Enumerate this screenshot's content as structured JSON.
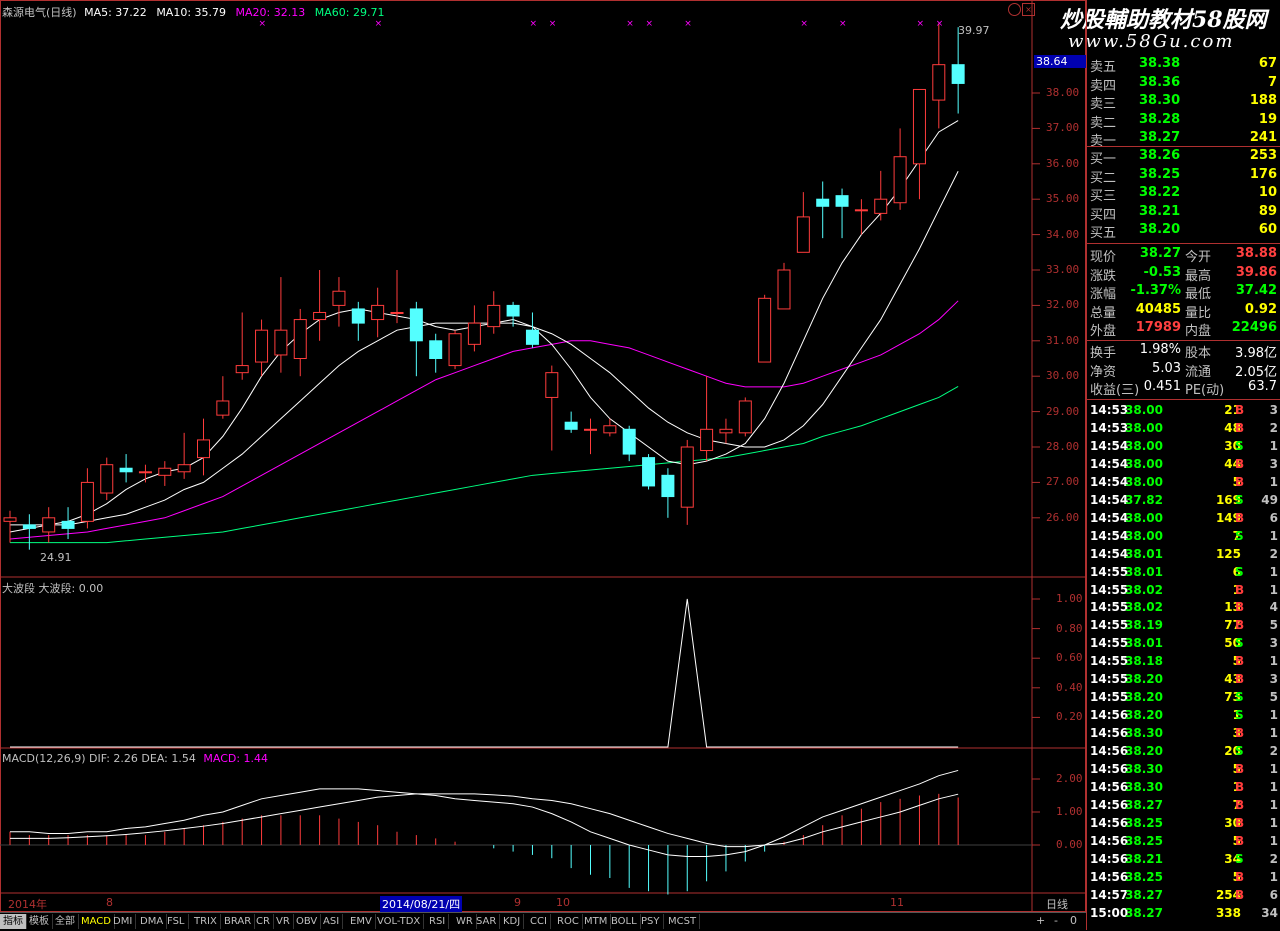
{
  "header": {
    "stock_name": "森源电气(日线)",
    "ma5": "MA5: 37.22",
    "ma10": "MA10: 35.79",
    "ma20": "MA20: 32.13",
    "ma60": "MA60: 29.71",
    "ma5_color": "#ffffff",
    "ma10_color": "#ffffff",
    "ma20_color": "#ff00ff",
    "ma60_color": "#00ff80"
  },
  "watermark": {
    "line1": "炒股輔助教材58股网",
    "line2": "www.58Gu.com"
  },
  "price_axis": {
    "labels": [
      "38.00",
      "37.00",
      "36.00",
      "35.00",
      "34.00",
      "33.00",
      "32.00",
      "31.00",
      "30.00",
      "29.00",
      "28.00",
      "27.00",
      "26.00"
    ],
    "current_tag": "38.64",
    "high_marker": "39.97",
    "low_marker": "24.91"
  },
  "indicator1": {
    "title": "大波段  大波段: 0.00",
    "axis": [
      "1.00",
      "0.80",
      "0.60",
      "0.40",
      "0.20"
    ]
  },
  "macd": {
    "title_prefix": "MACD(12,26,9)  DIF: 2.26  DEA: 1.54",
    "macd_value": "MACD: 1.44",
    "axis": [
      "2.00",
      "1.00",
      "0.00"
    ]
  },
  "x_axis": {
    "labels": [
      "2014年",
      "8",
      "2014/08/21/四",
      "9",
      "10",
      "11"
    ],
    "period": "日线"
  },
  "orderbook": {
    "asks": [
      {
        "label": "卖五",
        "price": "38.38",
        "vol": "67"
      },
      {
        "label": "卖四",
        "price": "38.36",
        "vol": "7"
      },
      {
        "label": "卖三",
        "price": "38.30",
        "vol": "188"
      },
      {
        "label": "卖二",
        "price": "38.28",
        "vol": "19"
      },
      {
        "label": "卖一",
        "price": "38.27",
        "vol": "241"
      }
    ],
    "bids": [
      {
        "label": "买一",
        "price": "38.26",
        "vol": "253"
      },
      {
        "label": "买二",
        "price": "38.25",
        "vol": "176"
      },
      {
        "label": "买三",
        "price": "38.22",
        "vol": "10"
      },
      {
        "label": "买四",
        "price": "38.21",
        "vol": "89"
      },
      {
        "label": "买五",
        "price": "38.20",
        "vol": "60"
      }
    ]
  },
  "stats": [
    {
      "l1": "现价",
      "v1": "38.27",
      "l2": "今开",
      "v2": "38.88",
      "c1": "#00ff00",
      "c2": "#ff4040"
    },
    {
      "l1": "涨跌",
      "v1": "-0.53",
      "l2": "最高",
      "v2": "39.86",
      "c1": "#00ff00",
      "c2": "#ff4040"
    },
    {
      "l1": "涨幅",
      "v1": "-1.37%",
      "l2": "最低",
      "v2": "37.42",
      "c1": "#00ff00",
      "c2": "#00ff00"
    },
    {
      "l1": "总量",
      "v1": "40485",
      "l2": "量比",
      "v2": "0.92",
      "c1": "#ffff00",
      "c2": "#ffff00"
    },
    {
      "l1": "外盘",
      "v1": "17989",
      "l2": "内盘",
      "v2": "22496",
      "c1": "#ff4040",
      "c2": "#00ff00"
    }
  ],
  "stats2": [
    {
      "l1": "换手",
      "v1": "1.98%",
      "l2": "股本",
      "v2": "3.98亿"
    },
    {
      "l1": "净资",
      "v1": "5.03",
      "l2": "流通",
      "v2": "2.05亿"
    },
    {
      "l1": "收益(三)",
      "v1": "0.451",
      "l2": "PE(动)",
      "v2": "63.7"
    }
  ],
  "ticks": [
    {
      "t": "14:53",
      "p": "38.00",
      "v": "21",
      "s": "B",
      "n": "3"
    },
    {
      "t": "14:53",
      "p": "38.00",
      "v": "48",
      "s": "B",
      "n": "2"
    },
    {
      "t": "14:54",
      "p": "38.00",
      "v": "30",
      "s": "S",
      "n": "1"
    },
    {
      "t": "14:54",
      "p": "38.00",
      "v": "44",
      "s": "B",
      "n": "3"
    },
    {
      "t": "14:54",
      "p": "38.00",
      "v": "5",
      "s": "B",
      "n": "1"
    },
    {
      "t": "14:54",
      "p": "37.82",
      "v": "169",
      "s": "S",
      "n": "49"
    },
    {
      "t": "14:54",
      "p": "38.00",
      "v": "149",
      "s": "B",
      "n": "6"
    },
    {
      "t": "14:54",
      "p": "38.00",
      "v": "7",
      "s": "S",
      "n": "1"
    },
    {
      "t": "14:54",
      "p": "38.01",
      "v": "125",
      "s": "",
      "n": "2"
    },
    {
      "t": "14:55",
      "p": "38.01",
      "v": "6",
      "s": "S",
      "n": "1"
    },
    {
      "t": "14:55",
      "p": "38.02",
      "v": "1",
      "s": "B",
      "n": "1"
    },
    {
      "t": "14:55",
      "p": "38.02",
      "v": "13",
      "s": "B",
      "n": "4"
    },
    {
      "t": "14:55",
      "p": "38.19",
      "v": "77",
      "s": "B",
      "n": "5"
    },
    {
      "t": "14:55",
      "p": "38.01",
      "v": "50",
      "s": "S",
      "n": "3"
    },
    {
      "t": "14:55",
      "p": "38.18",
      "v": "5",
      "s": "B",
      "n": "1"
    },
    {
      "t": "14:55",
      "p": "38.20",
      "v": "43",
      "s": "B",
      "n": "3"
    },
    {
      "t": "14:55",
      "p": "38.20",
      "v": "73",
      "s": "S",
      "n": "5"
    },
    {
      "t": "14:56",
      "p": "38.20",
      "v": "1",
      "s": "S",
      "n": "1"
    },
    {
      "t": "14:56",
      "p": "38.30",
      "v": "3",
      "s": "B",
      "n": "1"
    },
    {
      "t": "14:56",
      "p": "38.20",
      "v": "20",
      "s": "S",
      "n": "2"
    },
    {
      "t": "14:56",
      "p": "38.30",
      "v": "5",
      "s": "B",
      "n": "1"
    },
    {
      "t": "14:56",
      "p": "38.30",
      "v": "1",
      "s": "B",
      "n": "1"
    },
    {
      "t": "14:56",
      "p": "38.27",
      "v": "7",
      "s": "B",
      "n": "1"
    },
    {
      "t": "14:56",
      "p": "38.25",
      "v": "30",
      "s": "B",
      "n": "1"
    },
    {
      "t": "14:56",
      "p": "38.25",
      "v": "5",
      "s": "B",
      "n": "1"
    },
    {
      "t": "14:56",
      "p": "38.21",
      "v": "34",
      "s": "S",
      "n": "2"
    },
    {
      "t": "14:56",
      "p": "38.25",
      "v": "5",
      "s": "B",
      "n": "1"
    },
    {
      "t": "14:57",
      "p": "38.27",
      "v": "254",
      "s": "B",
      "n": "6"
    },
    {
      "t": "15:00",
      "p": "38.27",
      "v": "338",
      "s": "",
      "n": "34"
    }
  ],
  "tabs": [
    "指标",
    "模板",
    "全部",
    "MACD",
    "DMI",
    "DMA",
    "FSL",
    "TRIX",
    "BRAR",
    "CR",
    "VR",
    "OBV",
    "ASI",
    "EMV",
    "VOL-TDX",
    "RSI",
    "WR",
    "SAR",
    "KDJ",
    "CCI",
    "ROC",
    "MTM",
    "BOLL",
    "PSY",
    "MCST"
  ],
  "nav": {
    "plus": "+",
    "minus": "-",
    "zero": "0"
  },
  "candles": [
    {
      "o": 25.9,
      "c": 26.0,
      "h": 26.2,
      "l": 25.3
    },
    {
      "o": 25.8,
      "c": 25.7,
      "h": 26.1,
      "l": 25.1
    },
    {
      "o": 25.6,
      "c": 26.0,
      "h": 26.3,
      "l": 25.3
    },
    {
      "o": 25.9,
      "c": 25.7,
      "h": 26.3,
      "l": 25.4
    },
    {
      "o": 25.9,
      "c": 27.0,
      "h": 27.4,
      "l": 25.7
    },
    {
      "o": 26.7,
      "c": 27.5,
      "h": 27.7,
      "l": 26.5
    },
    {
      "o": 27.4,
      "c": 27.3,
      "h": 27.8,
      "l": 27.0
    },
    {
      "o": 27.3,
      "c": 27.3,
      "h": 27.5,
      "l": 27.0
    },
    {
      "o": 27.2,
      "c": 27.4,
      "h": 27.6,
      "l": 26.9
    },
    {
      "o": 27.3,
      "c": 27.5,
      "h": 28.4,
      "l": 27.1
    },
    {
      "o": 27.7,
      "c": 28.2,
      "h": 28.8,
      "l": 27.2
    },
    {
      "o": 28.9,
      "c": 29.3,
      "h": 30.0,
      "l": 28.8
    },
    {
      "o": 30.1,
      "c": 30.3,
      "h": 31.8,
      "l": 29.9
    },
    {
      "o": 30.4,
      "c": 31.3,
      "h": 31.6,
      "l": 30.0
    },
    {
      "o": 30.6,
      "c": 31.3,
      "h": 32.8,
      "l": 30.1
    },
    {
      "o": 30.5,
      "c": 31.6,
      "h": 31.9,
      "l": 30.0
    },
    {
      "o": 31.6,
      "c": 31.8,
      "h": 33.0,
      "l": 31.0
    },
    {
      "o": 32.0,
      "c": 32.4,
      "h": 32.8,
      "l": 31.4
    },
    {
      "o": 31.9,
      "c": 31.5,
      "h": 32.1,
      "l": 31.0
    },
    {
      "o": 31.6,
      "c": 32.0,
      "h": 32.5,
      "l": 31.1
    },
    {
      "o": 31.8,
      "c": 31.8,
      "h": 33.0,
      "l": 31.5
    },
    {
      "o": 31.9,
      "c": 31.0,
      "h": 32.1,
      "l": 30.0
    },
    {
      "o": 31.0,
      "c": 30.5,
      "h": 31.2,
      "l": 30.1
    },
    {
      "o": 30.3,
      "c": 31.2,
      "h": 31.3,
      "l": 30.2
    },
    {
      "o": 30.9,
      "c": 31.5,
      "h": 32.0,
      "l": 30.7
    },
    {
      "o": 31.4,
      "c": 32.0,
      "h": 32.4,
      "l": 31.2
    },
    {
      "o": 32.0,
      "c": 31.7,
      "h": 32.1,
      "l": 31.4
    },
    {
      "o": 31.3,
      "c": 30.9,
      "h": 31.8,
      "l": 30.8
    },
    {
      "o": 29.4,
      "c": 30.1,
      "h": 30.3,
      "l": 27.9
    },
    {
      "o": 28.7,
      "c": 28.5,
      "h": 29.0,
      "l": 28.4
    },
    {
      "o": 28.5,
      "c": 28.5,
      "h": 28.8,
      "l": 27.8
    },
    {
      "o": 28.4,
      "c": 28.6,
      "h": 28.8,
      "l": 28.3
    },
    {
      "o": 28.5,
      "c": 27.8,
      "h": 28.6,
      "l": 27.6
    },
    {
      "o": 27.7,
      "c": 26.9,
      "h": 27.8,
      "l": 26.8
    },
    {
      "o": 27.2,
      "c": 26.6,
      "h": 27.4,
      "l": 26.0
    },
    {
      "o": 26.3,
      "c": 28.0,
      "h": 28.2,
      "l": 25.8
    },
    {
      "o": 27.9,
      "c": 28.5,
      "h": 30.0,
      "l": 27.6
    },
    {
      "o": 28.4,
      "c": 28.5,
      "h": 28.8,
      "l": 28.1
    },
    {
      "o": 28.4,
      "c": 29.3,
      "h": 29.4,
      "l": 28.3
    },
    {
      "o": 30.4,
      "c": 32.2,
      "h": 32.3,
      "l": 30.4
    },
    {
      "o": 31.9,
      "c": 33.0,
      "h": 33.2,
      "l": 31.9
    },
    {
      "o": 33.5,
      "c": 34.5,
      "h": 35.2,
      "l": 33.5
    },
    {
      "o": 35.0,
      "c": 34.8,
      "h": 35.5,
      "l": 33.9
    },
    {
      "o": 35.1,
      "c": 34.8,
      "h": 35.3,
      "l": 33.9
    },
    {
      "o": 34.7,
      "c": 34.7,
      "h": 35.0,
      "l": 34.0
    },
    {
      "o": 34.6,
      "c": 35.0,
      "h": 35.8,
      "l": 34.4
    },
    {
      "o": 34.9,
      "c": 36.2,
      "h": 37.0,
      "l": 34.7
    },
    {
      "o": 36.0,
      "c": 38.1,
      "h": 38.1,
      "l": 35.0
    },
    {
      "o": 37.8,
      "c": 38.8,
      "h": 39.97,
      "l": 37.0
    },
    {
      "o": 38.8,
      "c": 38.27,
      "h": 39.86,
      "l": 37.42
    }
  ],
  "ma5_series": [
    25.6,
    25.7,
    25.8,
    25.9,
    26.1,
    26.4,
    26.8,
    27.1,
    27.3,
    27.4,
    27.7,
    28.3,
    29.1,
    30.0,
    30.7,
    31.2,
    31.6,
    31.8,
    31.9,
    31.8,
    31.7,
    31.6,
    31.4,
    31.3,
    31.4,
    31.5,
    31.6,
    31.4,
    30.9,
    30.2,
    29.4,
    28.8,
    28.4,
    28.0,
    27.6,
    27.5,
    27.6,
    27.8,
    28.1,
    28.8,
    29.8,
    31.0,
    32.2,
    33.2,
    34.0,
    34.6,
    35.3,
    36.1,
    36.9,
    37.22
  ],
  "ma10_series": [
    25.8,
    25.8,
    25.8,
    25.8,
    25.9,
    26.0,
    26.1,
    26.3,
    26.5,
    26.8,
    27.0,
    27.4,
    27.8,
    28.3,
    28.8,
    29.3,
    29.8,
    30.3,
    30.7,
    31.0,
    31.3,
    31.4,
    31.5,
    31.5,
    31.5,
    31.5,
    31.5,
    31.4,
    31.2,
    30.9,
    30.5,
    30.1,
    29.6,
    29.1,
    28.7,
    28.4,
    28.2,
    28.1,
    28.0,
    28.0,
    28.2,
    28.6,
    29.2,
    30.0,
    30.8,
    31.6,
    32.6,
    33.6,
    34.7,
    35.79
  ],
  "ma20_series": [
    25.4,
    25.45,
    25.5,
    25.55,
    25.6,
    25.7,
    25.8,
    25.9,
    26.0,
    26.2,
    26.4,
    26.6,
    26.9,
    27.2,
    27.5,
    27.8,
    28.1,
    28.4,
    28.7,
    29.0,
    29.3,
    29.6,
    29.9,
    30.1,
    30.3,
    30.5,
    30.7,
    30.8,
    30.9,
    31.0,
    31.0,
    30.9,
    30.8,
    30.6,
    30.4,
    30.2,
    30.0,
    29.8,
    29.7,
    29.7,
    29.7,
    29.8,
    30.0,
    30.2,
    30.4,
    30.6,
    30.9,
    31.2,
    31.6,
    32.13
  ],
  "ma60_series": [
    25.3,
    25.3,
    25.3,
    25.3,
    25.3,
    25.3,
    25.35,
    25.4,
    25.45,
    25.5,
    25.55,
    25.6,
    25.7,
    25.8,
    25.9,
    26.0,
    26.1,
    26.2,
    26.3,
    26.4,
    26.5,
    26.6,
    26.7,
    26.8,
    26.9,
    27.0,
    27.1,
    27.2,
    27.25,
    27.3,
    27.35,
    27.4,
    27.45,
    27.5,
    27.55,
    27.6,
    27.65,
    27.7,
    27.8,
    27.9,
    28.0,
    28.1,
    28.3,
    28.45,
    28.6,
    28.8,
    29.0,
    29.2,
    29.4,
    29.71
  ],
  "macd_bars": [
    0.4,
    0.3,
    0.3,
    0.3,
    0.3,
    0.3,
    0.3,
    0.3,
    0.4,
    0.5,
    0.6,
    0.7,
    0.8,
    0.9,
    0.9,
    0.9,
    0.9,
    0.8,
    0.7,
    0.6,
    0.4,
    0.3,
    0.2,
    0.1,
    0.0,
    -0.1,
    -0.2,
    -0.3,
    -0.4,
    -0.7,
    -0.9,
    -1.0,
    -1.3,
    -1.4,
    -1.5,
    -1.4,
    -1.1,
    -0.8,
    -0.5,
    -0.2,
    0.1,
    0.3,
    0.6,
    0.9,
    1.1,
    1.3,
    1.4,
    1.5,
    1.55,
    1.44
  ],
  "dif_series": [
    0.4,
    0.4,
    0.35,
    0.35,
    0.4,
    0.4,
    0.5,
    0.55,
    0.65,
    0.75,
    0.9,
    1.0,
    1.2,
    1.4,
    1.5,
    1.6,
    1.7,
    1.7,
    1.7,
    1.65,
    1.6,
    1.55,
    1.5,
    1.4,
    1.35,
    1.3,
    1.25,
    1.15,
    0.95,
    0.7,
    0.4,
    0.2,
    0.0,
    -0.15,
    -0.3,
    -0.35,
    -0.35,
    -0.3,
    -0.2,
    0.0,
    0.25,
    0.55,
    0.85,
    1.05,
    1.25,
    1.45,
    1.65,
    1.85,
    2.1,
    2.26
  ],
  "dea_series": [
    0.2,
    0.2,
    0.2,
    0.22,
    0.25,
    0.28,
    0.32,
    0.37,
    0.43,
    0.5,
    0.57,
    0.65,
    0.75,
    0.85,
    0.95,
    1.05,
    1.15,
    1.25,
    1.35,
    1.45,
    1.5,
    1.55,
    1.55,
    1.55,
    1.55,
    1.52,
    1.48,
    1.4,
    1.35,
    1.25,
    1.1,
    0.95,
    0.75,
    0.55,
    0.35,
    0.2,
    0.05,
    -0.05,
    -0.05,
    0.0,
    0.05,
    0.2,
    0.4,
    0.55,
    0.7,
    0.85,
    1.0,
    1.2,
    1.4,
    1.54
  ],
  "boduan_series": [
    0,
    0,
    0,
    0,
    0,
    0,
    0,
    0,
    0,
    0,
    0,
    0,
    0,
    0,
    0,
    0,
    0,
    0,
    0,
    0,
    0,
    0,
    0,
    0,
    0,
    0,
    0,
    0,
    0,
    0,
    0,
    0,
    0,
    0,
    0,
    1,
    0,
    0,
    0,
    0,
    0,
    0,
    0,
    0,
    0,
    0,
    0,
    0,
    0,
    0
  ],
  "markers_x": [
    13,
    19,
    27,
    28,
    32,
    33,
    35,
    41,
    43,
    47,
    48
  ]
}
